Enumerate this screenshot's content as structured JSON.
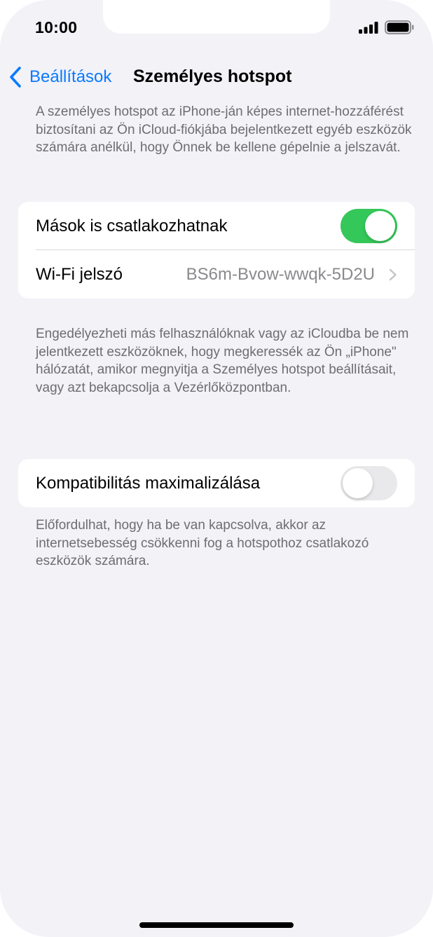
{
  "status_bar": {
    "time": "10:00"
  },
  "navigation": {
    "back_label": "Beállítások",
    "title": "Személyes hotspot"
  },
  "intro_text": "A személyes hotspot az iPhone-ján képes internet-hozzáférést biztosítani az Ön iCloud-fiókjába bejelentkezett egyéb eszközök számára anélkül, hogy Önnek be kellene gépelnie a jelszavát.",
  "group_sharing": {
    "allow_others": {
      "label": "Mások is csatlakozhatnak",
      "state": "on"
    },
    "wifi_password": {
      "label": "Wi-Fi jelszó",
      "value": "BS6m-Bvow-wwqk-5D2U"
    }
  },
  "sharing_footer": "Engedélyezheti más felhasználóknak vagy az iCloudba be nem jelentkezett eszközöknek, hogy megkeressék az Ön „iPhone\" hálózatát, amikor megnyitja a Személyes hotspot beállításait, vagy azt bekapcsolja a Vezérlőközpontban.",
  "group_compat": {
    "maximize_compatibility": {
      "label": "Kompatibilitás maximalizálása",
      "state": "off"
    }
  },
  "compat_footer": "Előfordulhat, hogy ha be van kapcsolva, akkor az internetsebesség csökkenni fog a hotspothoz csatlakozó eszközök számára.",
  "colors": {
    "accent": "#0a7aff",
    "toggle_on": "#34c759",
    "toggle_off": "#e9e9eb",
    "background": "#f2f2f7",
    "secondary_text": "#6d6d72"
  },
  "icons": {
    "signal": "cellular-signal-icon",
    "battery": "battery-icon",
    "back": "chevron-left-icon",
    "disclosure": "chevron-right-icon"
  }
}
